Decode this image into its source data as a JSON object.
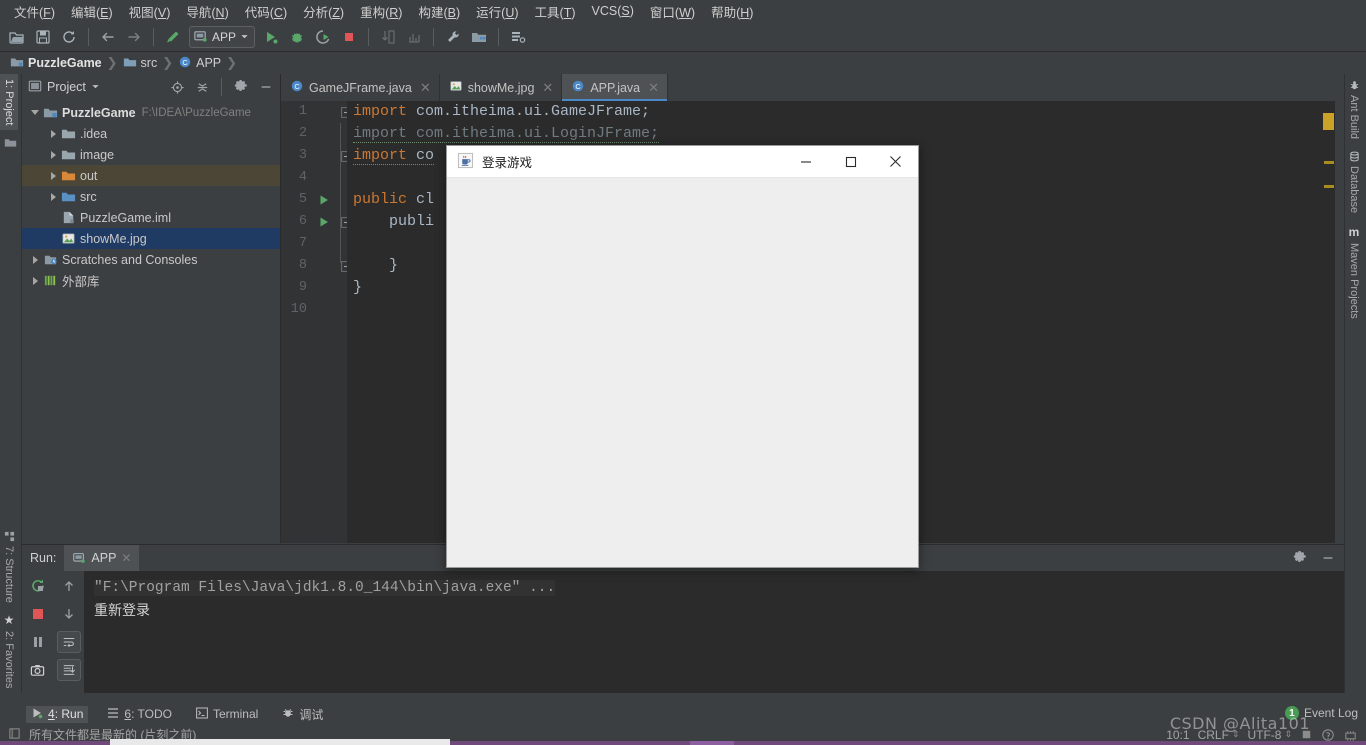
{
  "menu": {
    "items": [
      {
        "label": "文件(F)",
        "mn": "F"
      },
      {
        "label": "编辑(E)",
        "mn": "E"
      },
      {
        "label": "视图(V)",
        "mn": "V"
      },
      {
        "label": "导航(N)",
        "mn": "N"
      },
      {
        "label": "代码(C)",
        "mn": "C"
      },
      {
        "label": "分析(Z)",
        "mn": "Z"
      },
      {
        "label": "重构(R)",
        "mn": "R"
      },
      {
        "label": "构建(B)",
        "mn": "B"
      },
      {
        "label": "运行(U)",
        "mn": "U"
      },
      {
        "label": "工具(T)",
        "mn": "T"
      },
      {
        "label": "VCS(S)",
        "mn": "S"
      },
      {
        "label": "窗口(W)",
        "mn": "W"
      },
      {
        "label": "帮助(H)",
        "mn": "H"
      }
    ]
  },
  "toolbar": {
    "run_config": "APP",
    "icons": [
      "open-folder-icon",
      "save-all-icon",
      "sync-icon",
      "back-icon",
      "forward-icon",
      "build-hammer-icon",
      "run-icon",
      "debug-icon",
      "run-coverage-icon",
      "stop-icon",
      "update-app-icon",
      "profile-icon",
      "settings-wrench-icon",
      "project-structure-icon",
      "sdk-manager-icon",
      "search-everywhere-icon"
    ]
  },
  "breadcrumb": {
    "items": [
      {
        "label": "PuzzleGame",
        "icon": "module-icon",
        "bold": true
      },
      {
        "label": "src",
        "icon": "folder-icon",
        "bold": false
      },
      {
        "label": "APP",
        "icon": "class-icon",
        "bold": false
      }
    ]
  },
  "left_stripe": {
    "top": [
      {
        "label": "1: Project",
        "active": true
      }
    ],
    "bottom": [
      {
        "label": "7: Structure"
      },
      {
        "label": "2: Favorites"
      }
    ]
  },
  "right_stripe": {
    "items": [
      {
        "label": "Ant Build",
        "icon": "ant-icon"
      },
      {
        "label": "Database",
        "icon": "database-icon"
      },
      {
        "label": "Maven Projects",
        "icon": "maven-icon"
      }
    ]
  },
  "project_panel": {
    "title": "Project",
    "header_icons": [
      "locate-icon",
      "collapse-all-icon",
      "gear-icon",
      "hide-icon"
    ],
    "tree": [
      {
        "indent": 0,
        "arrow": "down",
        "icon": "module-icon",
        "name": "PuzzleGame",
        "bold": true,
        "path": "F:\\IDEA\\PuzzleGame",
        "state": "none"
      },
      {
        "indent": 1,
        "arrow": "right",
        "icon": "folder-icon",
        "name": ".idea",
        "bold": false,
        "path": "",
        "state": "none"
      },
      {
        "indent": 1,
        "arrow": "right",
        "icon": "folder-icon",
        "name": "image",
        "bold": false,
        "path": "",
        "state": "none"
      },
      {
        "indent": 1,
        "arrow": "right",
        "icon": "folder-orange-icon",
        "name": "out",
        "bold": false,
        "path": "",
        "state": "brown"
      },
      {
        "indent": 1,
        "arrow": "right",
        "icon": "folder-src-icon",
        "name": "src",
        "bold": false,
        "path": "",
        "state": "none"
      },
      {
        "indent": 1,
        "arrow": "none",
        "icon": "iml-icon",
        "name": "PuzzleGame.iml",
        "bold": false,
        "path": "",
        "state": "none"
      },
      {
        "indent": 1,
        "arrow": "none",
        "icon": "image-icon",
        "name": "showMe.jpg",
        "bold": false,
        "path": "",
        "state": "blue"
      },
      {
        "indent": 0,
        "arrow": "right",
        "icon": "scratch-icon",
        "name": "Scratches and Consoles",
        "bold": false,
        "path": "",
        "state": "none"
      },
      {
        "indent": 0,
        "arrow": "right",
        "icon": "library-icon",
        "name": "外部库",
        "bold": false,
        "path": "",
        "state": "none"
      }
    ]
  },
  "editor": {
    "tabs": [
      {
        "label": "GameJFrame.java",
        "icon": "class-icon",
        "active": false
      },
      {
        "label": "showMe.jpg",
        "icon": "image-icon",
        "active": false
      },
      {
        "label": "APP.java",
        "icon": "class-icon",
        "active": true
      }
    ],
    "lines": [
      {
        "num": "1",
        "text": "import com.itheima.ui.GameJFrame;",
        "kw": "import",
        "dim": false,
        "wavy": false,
        "fold": "minus",
        "run": false
      },
      {
        "num": "2",
        "text": "import com.itheima.ui.LoginJFrame;",
        "kw": "import",
        "dim": true,
        "wavy": true,
        "fold": "none",
        "run": false
      },
      {
        "num": "3",
        "text": "import co",
        "kw": "import",
        "dim": false,
        "wavy": true,
        "fold": "minus",
        "run": false
      },
      {
        "num": "4",
        "text": "",
        "kw": "",
        "dim": false,
        "wavy": false,
        "fold": "none",
        "run": false
      },
      {
        "num": "5",
        "text": "public cl",
        "kw": "public",
        "dim": false,
        "wavy": false,
        "fold": "none",
        "run": true
      },
      {
        "num": "6",
        "text": "    publi",
        "kw": "public",
        "dim": false,
        "wavy": false,
        "fold": "minus",
        "run": true
      },
      {
        "num": "7",
        "text": "",
        "kw": "",
        "dim": false,
        "wavy": false,
        "fold": "none",
        "run": false
      },
      {
        "num": "8",
        "text": "    }",
        "kw": "",
        "dim": false,
        "wavy": false,
        "fold": "minus",
        "run": false
      },
      {
        "num": "9",
        "text": "}",
        "kw": "",
        "dim": false,
        "wavy": false,
        "fold": "none",
        "run": false
      },
      {
        "num": "10",
        "text": "",
        "kw": "",
        "dim": false,
        "wavy": false,
        "fold": "none",
        "run": false
      }
    ],
    "scroll_markers": [
      "#c9a227",
      "#a98b20",
      "#a98b20"
    ]
  },
  "run_panel": {
    "label": "Run:",
    "tab": "APP",
    "tool_icons": [
      "rerun-icon",
      "stop-icon",
      "pause-icon",
      "camera-icon",
      "up-arrow-icon",
      "down-arrow-icon",
      "soft-wrap-icon",
      "scroll-to-end-icon"
    ],
    "right_icons": [
      "gear-icon",
      "hide-icon"
    ],
    "console": [
      {
        "text": "\"F:\\Program Files\\Java\\jdk1.8.0_144\\bin\\java.exe\" ...",
        "style": "path"
      },
      {
        "text": "重新登录",
        "style": "zh"
      }
    ]
  },
  "dialog": {
    "title": "登录游戏",
    "icon": "java-cup-icon",
    "buttons": [
      {
        "name": "minimize",
        "glyph": "—"
      },
      {
        "name": "maximize",
        "glyph": "☐"
      },
      {
        "name": "close",
        "glyph": "✕"
      }
    ]
  },
  "bottom_tabs": [
    {
      "label": "4: Run",
      "icon": "run-icon",
      "active": true
    },
    {
      "label": "6: TODO",
      "icon": "todo-icon",
      "active": false
    },
    {
      "label": "Terminal",
      "icon": "terminal-icon",
      "active": false
    },
    {
      "label": "调试",
      "icon": "debug-icon",
      "active": false
    }
  ],
  "event_log": {
    "count": "1",
    "label": "Event Log"
  },
  "status_bar": {
    "message": "所有文件都是最新的 (片刻之前)",
    "caret": "10:1",
    "line_sep": "CRLF",
    "encoding": "UTF-8",
    "icons": [
      "lock-icon",
      "branch-icon",
      "inspection-icon"
    ]
  },
  "watermark": "CSDN @Alita101",
  "colors": {
    "accent_blue": "#4a88c7",
    "editor_bg": "#2b2b2b",
    "panel_bg": "#3c3f41",
    "keyword": "#cc7832",
    "selection_blue": "#1f3b63",
    "warning": "#c9a227",
    "dialog_bg": "#eeeeee"
  }
}
